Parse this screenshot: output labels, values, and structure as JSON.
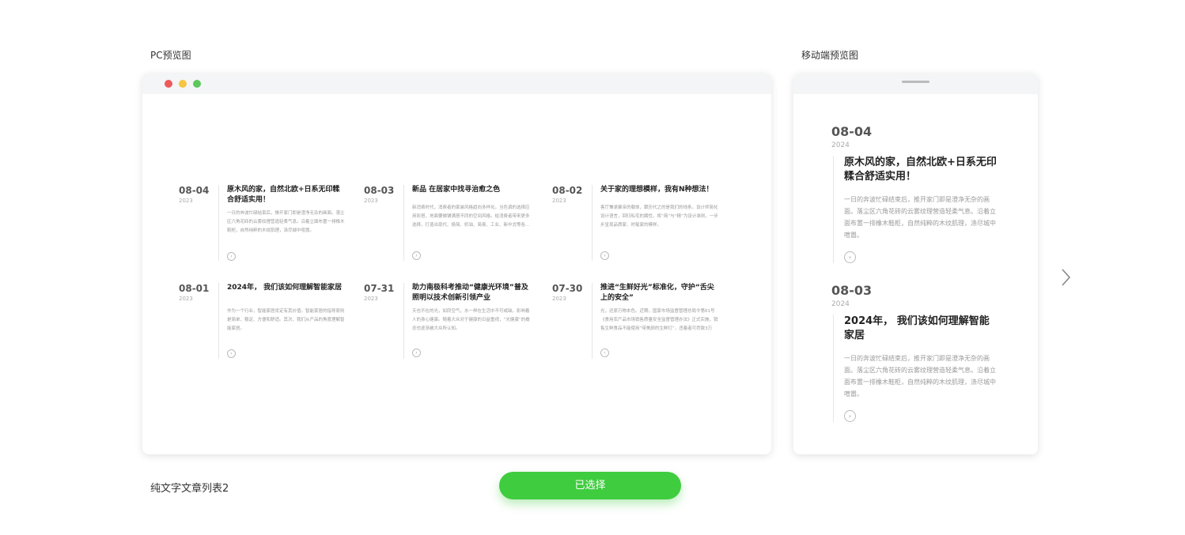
{
  "labels": {
    "pc_preview": "PC预览图",
    "mobile_preview": "移动端预览图",
    "template_name": "纯文字文章列表2"
  },
  "button": {
    "selected_label": "已选择"
  },
  "colors": {
    "accent": "#3fcc3f",
    "dot_red": "#ee5a5a",
    "dot_yellow": "#f6c542",
    "dot_green": "#5ac85a"
  },
  "icons": {
    "next": "chevron-right-icon",
    "item_arrow": "circle-arrow-icon"
  },
  "pc_articles": [
    {
      "date": "08-04",
      "year": "2023",
      "title": "原木风的家，自然北欧+日系无印糅合舒适实用！",
      "desc": "一日的奔波忙碌结束后，推开家门即是澄净无杂的画面。落尘区六角花砖的云雾纹理营造轻柔气息。沿着立面布置一排橡木鞋柜，自然纯粹的木纹肌理，涤尽城中喧嚣。"
    },
    {
      "date": "08-03",
      "year": "2023",
      "title": "新品 在居家中找寻治愈之色",
      "desc": "新消费时代，消费者的家装风格趋向多样化。当色调的选择应用彩搭，地面要做铺满搭不同的空间风格。给消费者带来更多选择，打造出现代、极简、奶油、简易、工业、新中式等各…"
    },
    {
      "date": "08-02",
      "year": "2023",
      "title": "关于家的理想模样，我有N种想法！",
      "desc": "客厅兼承聚亲的载体，跟历代之的是我们的线条。设计师简化设计语言，回归私宅的属性，将“简”与“精”为设计准则，一步步呈现品质家、时髦家的模样。"
    },
    {
      "date": "08-01",
      "year": "2023",
      "title": "2024年， 我们该如何理解智能家居",
      "desc": "作为一个行业，智能家居肯定有其价值。智能家居的指导原则是简单、稳定、方便和舒适。其次，我们从产品的角度理解智能家居。"
    },
    {
      "date": "07-31",
      "year": "2023",
      "title": "助力南极科考推动“健康光环境”普及 照明以技术创新引领产业",
      "desc": "天也不在的光，如同空气，水一样在生活中不可或缺。影响着人的身心健康。随着大众对于健康的日益重视，“光健康”的概念也逐渐被大众所认知。"
    },
    {
      "date": "07-30",
      "year": "2023",
      "title": "推进“生鲜好光”标准化，守护“舌尖上的安全”",
      "desc": "光，还原万物本色。近期，国家市场监督管理总局令第61号《食用农产品市场销售质量安全监督管理办法》正式实施，销售生鲜食品不能使用“带美颜的生鲜灯”，违着者可罚款3万元。"
    }
  ],
  "mobile_articles": [
    {
      "date": "08-04",
      "year": "2024",
      "title": "原木风的家，自然北欧+日系无印糅合舒适实用！",
      "desc": "一日的奔波忙碌结束后，推开家门即是澄净无杂的画面。落尘区六角花砖的云雾纹理营造轻柔气息。沿着立面布置一排橡木鞋柜，自然纯粹的木纹肌理，涤尽城中喧嚣。"
    },
    {
      "date": "08-03",
      "year": "2024",
      "title": "2024年， 我们该如何理解智能家居",
      "desc": "一日的奔波忙碌结束后，推开家门即是澄净无杂的画面。落尘区六角花砖的云雾纹理营造轻柔气息。沿着立面布置一排橡木鞋柜，自然纯粹的木纹肌理，涤尽城中喧嚣。"
    }
  ]
}
